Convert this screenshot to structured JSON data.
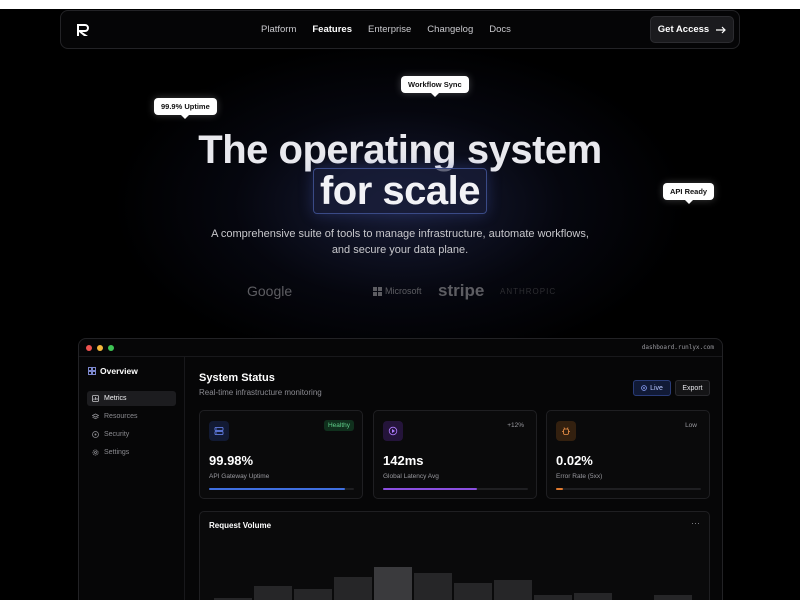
{
  "nav": {
    "links": [
      {
        "label": "Platform",
        "active": false
      },
      {
        "label": "Features",
        "active": true
      },
      {
        "label": "Enterprise",
        "active": false
      },
      {
        "label": "Changelog",
        "active": false
      },
      {
        "label": "Docs",
        "active": false
      }
    ],
    "cta_label": "Get Access"
  },
  "badges": {
    "uptime": "99.9% Uptime",
    "workflow": "Workflow Sync",
    "api": "API Ready"
  },
  "hero": {
    "title_line1": "The operating system",
    "title_line2": "for scale",
    "subtitle_line1": "A comprehensive suite of tools to manage infrastructure, automate workflows,",
    "subtitle_line2": "and secure your data plane."
  },
  "logos": {
    "google": "Google",
    "microsoft": "Microsoft",
    "stripe": "stripe",
    "anthropic": "ANTHROPIC"
  },
  "dashboard": {
    "url": "dashboard.runlyx.com",
    "sidebar": {
      "title": "Overview",
      "items": [
        {
          "label": "Metrics",
          "active": true
        },
        {
          "label": "Resources",
          "active": false
        },
        {
          "label": "Security",
          "active": false
        },
        {
          "label": "Settings",
          "active": false
        }
      ]
    },
    "title": "System Status",
    "subtitle": "Real-time infrastructure monitoring",
    "live_label": "Live",
    "export_label": "Export",
    "cards": [
      {
        "tag": "Healthy",
        "value": "99.98%",
        "label": "API Gateway Uptime",
        "progress": 0.94,
        "color": "#3f6fe0"
      },
      {
        "tag": "+12%",
        "value": "142ms",
        "label": "Global Latency Avg",
        "progress": 0.65,
        "color": "#8b4fe0"
      },
      {
        "tag": "Low",
        "value": "0.02%",
        "label": "Error Rate (5xx)",
        "progress": 0.05,
        "color": "#e07a2f"
      }
    ],
    "chart": {
      "title": "Request Volume",
      "menu": "···"
    }
  },
  "colors": {
    "accent_blue": "#3f6fe0",
    "accent_purple": "#8b4fe0",
    "accent_orange": "#e07a2f",
    "healthy_green": "#5fce8a"
  },
  "chart_data": {
    "type": "bar",
    "values": [
      24,
      36,
      33,
      45,
      55,
      49,
      39,
      42,
      27,
      29,
      17,
      27
    ]
  }
}
